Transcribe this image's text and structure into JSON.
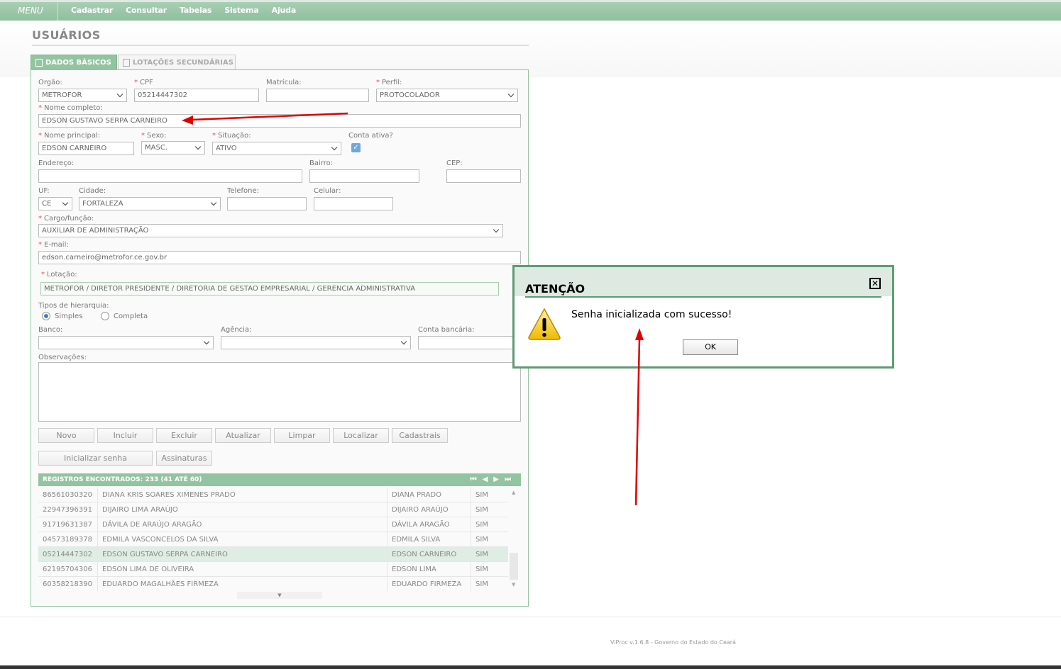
{
  "topbar": {
    "menu_label": "MENU",
    "nav": [
      "Cadastrar",
      "Consultar",
      "Tabelas",
      "Sistema",
      "Ajuda"
    ]
  },
  "page": {
    "title": "USUÁRIOS"
  },
  "tabs": [
    {
      "label": "DADOS BÁSICOS",
      "active": true
    },
    {
      "label": "LOTAÇÕES SECUNDÁRIAS",
      "active": false
    }
  ],
  "form": {
    "orgao": {
      "label": "Orgão:",
      "value": "METROFOR"
    },
    "cpf": {
      "label": "CPF",
      "value": "05214447302"
    },
    "matricula": {
      "label": "Matrícula:",
      "value": ""
    },
    "perfil": {
      "label": "Perfil:",
      "value": "PROTOCOLADOR"
    },
    "nome_completo": {
      "label": "Nome completo:",
      "value": "EDSON GUSTAVO SERPA CARNEIRO"
    },
    "nome_principal": {
      "label": "Nome principal:",
      "value": "EDSON CARNEIRO"
    },
    "sexo": {
      "label": "Sexo:",
      "value": "MASC."
    },
    "situacao": {
      "label": "Situação:",
      "value": "ATIVO"
    },
    "conta_ativa": {
      "label": "Conta ativa?",
      "checked": true
    },
    "endereco": {
      "label": "Endereço:",
      "value": ""
    },
    "bairro": {
      "label": "Bairro:",
      "value": ""
    },
    "cep": {
      "label": "CEP:",
      "value": ""
    },
    "uf": {
      "label": "UF:",
      "value": "CE"
    },
    "cidade": {
      "label": "Cidade:",
      "value": "FORTALEZA"
    },
    "telefone": {
      "label": "Telefone:",
      "value": ""
    },
    "celular": {
      "label": "Celular:",
      "value": ""
    },
    "cargo": {
      "label": "Cargo/função:",
      "value": "AUXILIAR DE ADMINISTRAÇÃO"
    },
    "email": {
      "label": "E-mail:",
      "value": "edson.carneiro@metrofor.ce.gov.br"
    },
    "lotacao": {
      "label": "Lotação:",
      "value": "METROFOR / DIRETOR PRESIDENTE / DIRETORIA DE GESTAO EMPRESARIAL / GERENCIA ADMINISTRATIVA"
    },
    "hierarquia": {
      "label": "Tipos de hierarquia:",
      "options": [
        "Simples",
        "Completa"
      ],
      "selected": "Simples"
    },
    "banco": {
      "label": "Banco:",
      "value": ""
    },
    "agencia": {
      "label": "Agência:",
      "value": ""
    },
    "conta_bancaria": {
      "label": "Conta bancária:",
      "value": ""
    },
    "observacoes": {
      "label": "Observações:",
      "value": ""
    }
  },
  "buttons": {
    "row1": [
      "Novo",
      "Incluir",
      "Excluir",
      "Atualizar",
      "Limpar",
      "Localizar",
      "Cadastrais"
    ],
    "row2": [
      "Inicializar senha",
      "Assinaturas"
    ]
  },
  "grid": {
    "header": "REGISTROS ENCONTRADOS: 233 (41 ATÉ 60)",
    "pager": [
      "⏮",
      "◀",
      "▶",
      "⏭"
    ],
    "rows": [
      [
        "86561030320",
        "DIANA KRIS SOARES XIMENES PRADO",
        "DIANA PRADO",
        "SIM"
      ],
      [
        "22947396391",
        "DIJAIRO LIMA ARAÚJO",
        "DIJAIRO ARAÚJO",
        "SIM"
      ],
      [
        "91719631387",
        "DÁVILA DE ARAÚJO ARAGÃO",
        "DÁVILA ARAGÃO",
        "SIM"
      ],
      [
        "04573189378",
        "EDMILA VASCONCELOS DA SILVA",
        "EDMILA SILVA",
        "SIM"
      ],
      [
        "05214447302",
        "EDSON GUSTAVO SERPA CARNEIRO",
        "EDSON CARNEIRO",
        "SIM"
      ],
      [
        "62195704306",
        "EDSON LIMA DE OLIVEIRA",
        "EDSON LIMA",
        "SIM"
      ],
      [
        "60358218390",
        "EDUARDO MAGALHÃES FIRMEZA",
        "EDUARDO FIRMEZA",
        "SIM"
      ]
    ],
    "selected_row": 4
  },
  "footer": {
    "text": "ViProc v.1.6.8 - Governo do Estado do Ceará"
  },
  "dialog": {
    "title": "ATENÇÃO",
    "message": "Senha inicializada com sucesso!",
    "ok_label": "OK"
  },
  "colors": {
    "accent": "#93c4a1",
    "dialog_border": "#5e9b74",
    "annotation": "#e00000"
  }
}
